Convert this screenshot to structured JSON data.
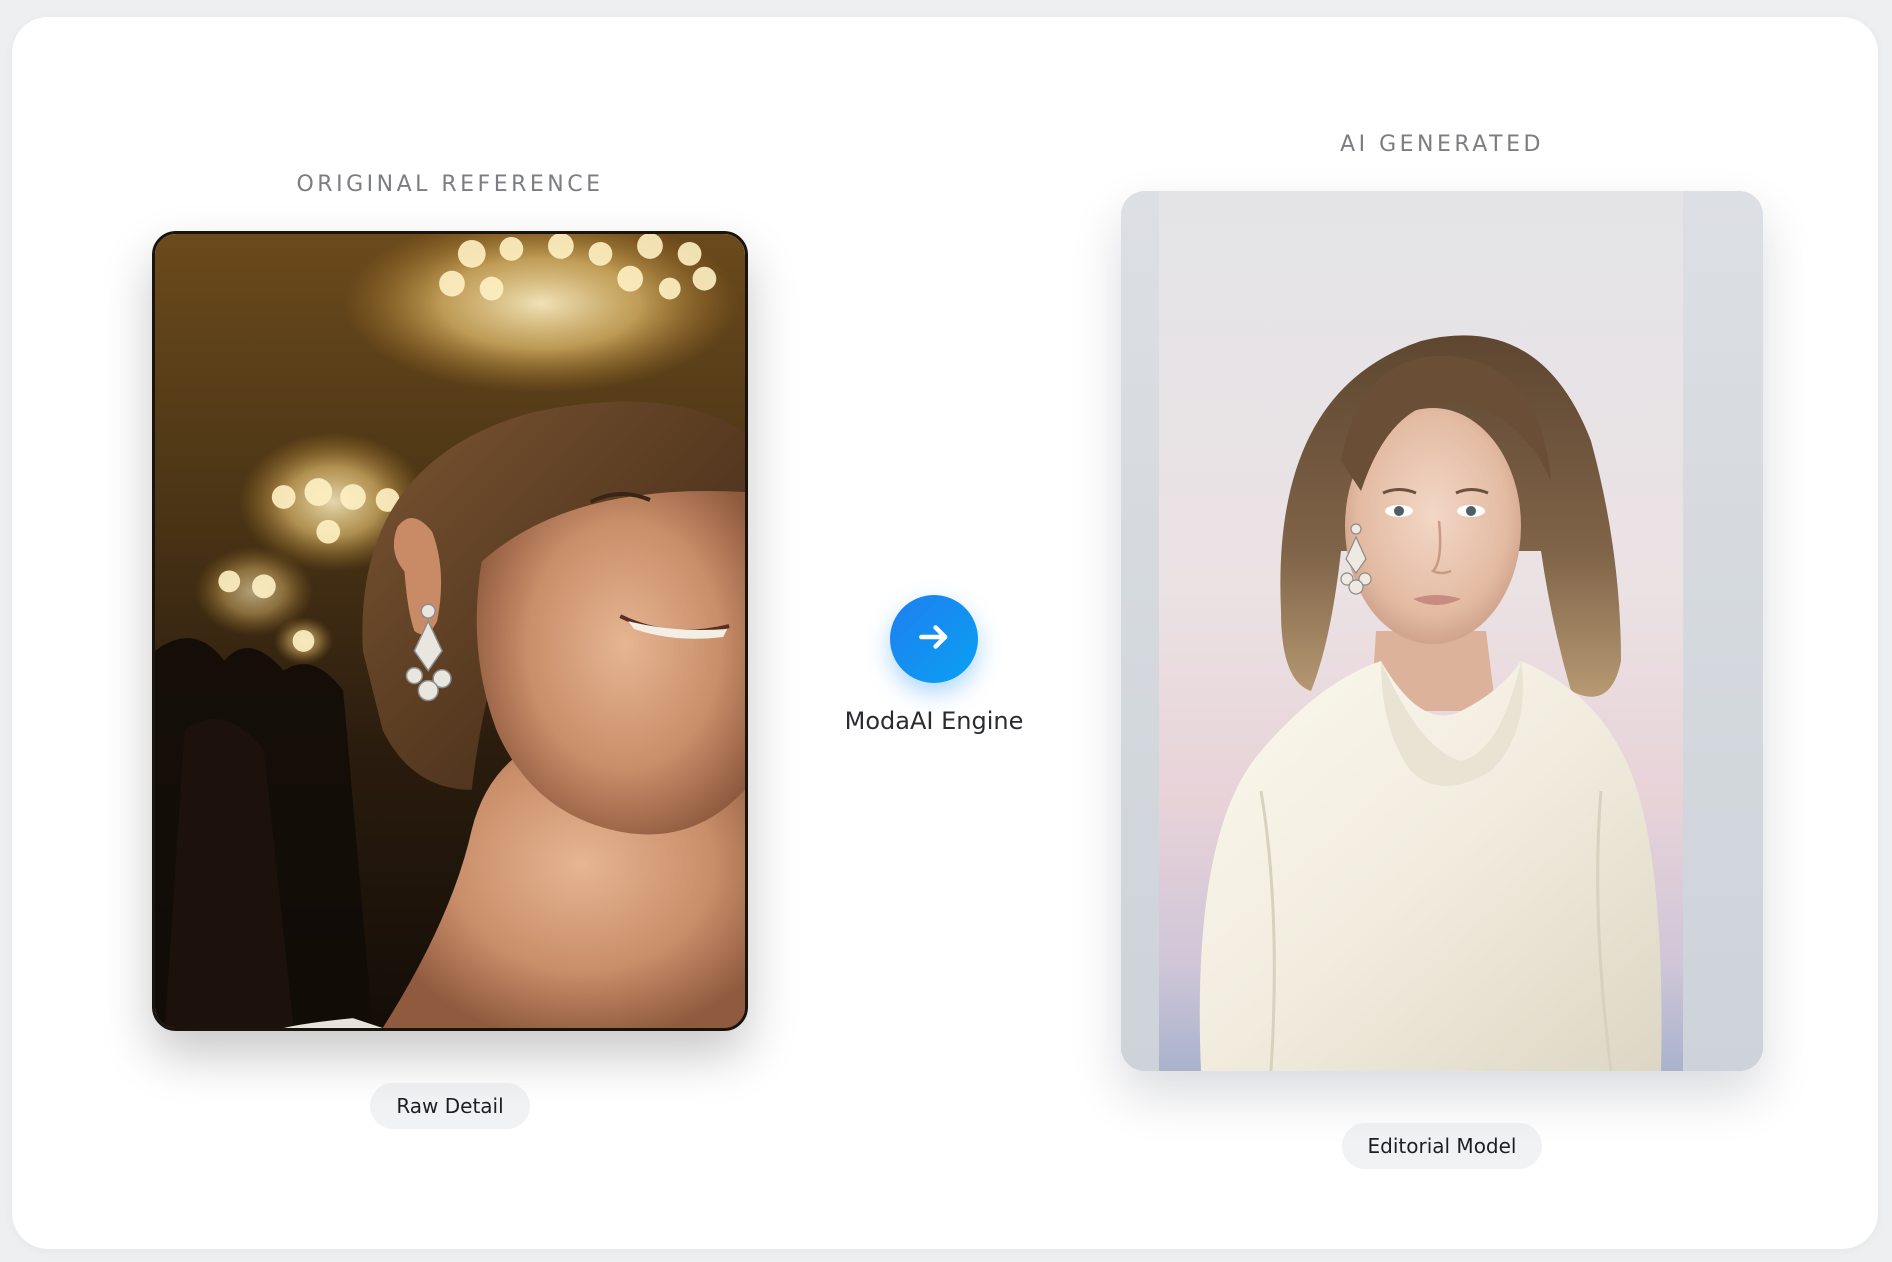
{
  "original": {
    "heading": "ORIGINAL REFERENCE",
    "badge": "Raw Detail"
  },
  "generated": {
    "heading": "AI GENERATED",
    "badge": "Editorial Model"
  },
  "engine": {
    "label": "ModaAI Engine",
    "icon": "arrow-right-icon",
    "color": "#1e88f0"
  }
}
